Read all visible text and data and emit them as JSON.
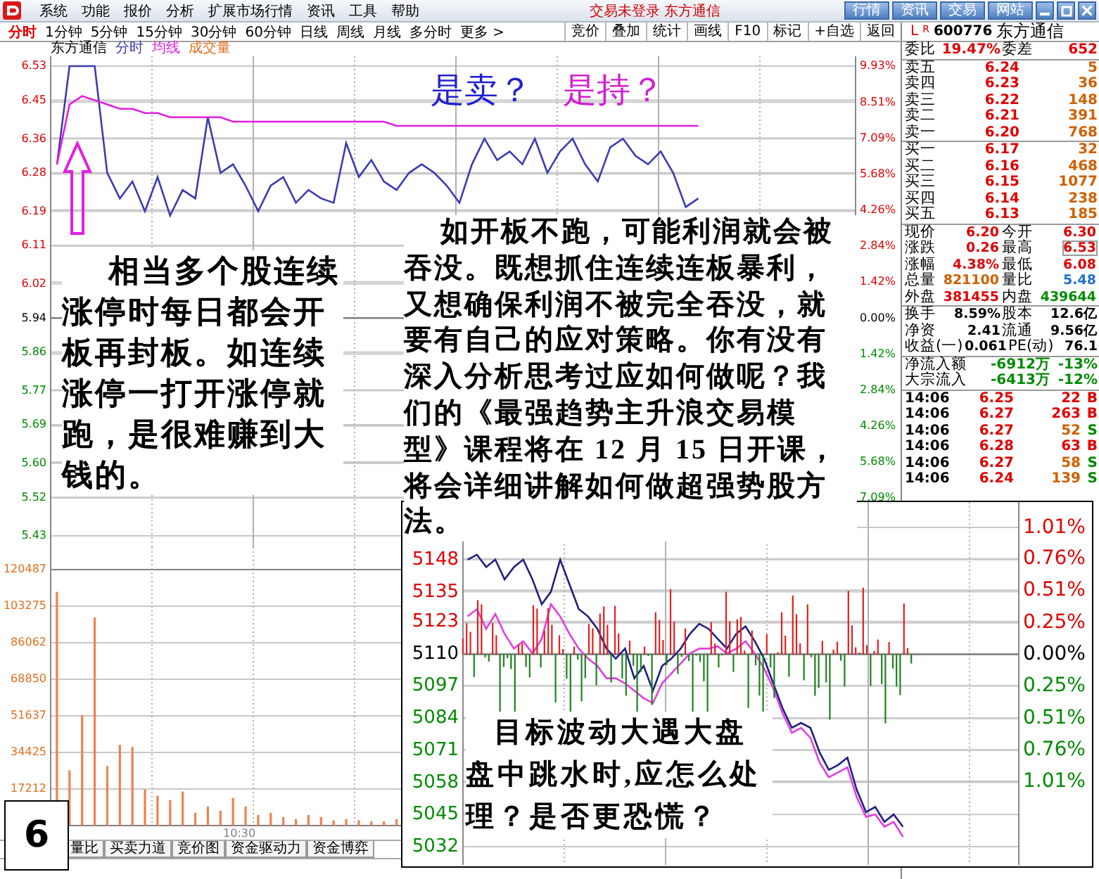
{
  "window": {
    "title": "交易未登录 东方通信"
  },
  "menu": [
    "系统",
    "功能",
    "报价",
    "分析",
    "扩展市场行情",
    "资讯",
    "工具",
    "帮助"
  ],
  "top_buttons": [
    "行情",
    "资讯",
    "交易",
    "网站"
  ],
  "periods": [
    {
      "label": "分时",
      "selected": true
    },
    {
      "label": "1分钟",
      "selected": false
    },
    {
      "label": "5分钟",
      "selected": false
    },
    {
      "label": "15分钟",
      "selected": false
    },
    {
      "label": "30分钟",
      "selected": false
    },
    {
      "label": "60分钟",
      "selected": false
    },
    {
      "label": "日线",
      "selected": false
    },
    {
      "label": "周线",
      "selected": false
    },
    {
      "label": "月线",
      "selected": false
    },
    {
      "label": "多分时",
      "selected": false
    },
    {
      "label": "更多 >",
      "selected": false
    }
  ],
  "tools": [
    "竞价",
    "叠加",
    "统计",
    "画线",
    "F10",
    "标记",
    "+自选",
    "返回"
  ],
  "chart_header": {
    "stock": "东方通信"
  },
  "price_chart": {
    "chart_data": {
      "type": "line",
      "grid": true,
      "ylim": [
        5.43,
        6.53
      ],
      "y2lim": [
        -8.59,
        9.93
      ],
      "yticks": [
        {
          "value": 6.53,
          "label": "6.53"
        },
        {
          "value": 6.45,
          "label": "6.45"
        },
        {
          "value": 6.36,
          "label": "6.36"
        },
        {
          "value": 6.28,
          "label": "6.28"
        },
        {
          "value": 6.19,
          "label": "6.19"
        },
        {
          "value": 6.11,
          "label": "6.11"
        },
        {
          "value": 6.02,
          "label": "6.02"
        },
        {
          "value": 5.94,
          "label": "5.94"
        },
        {
          "value": 5.86,
          "label": "5.86"
        },
        {
          "value": 5.77,
          "label": "5.77"
        },
        {
          "value": 5.69,
          "label": "5.69"
        },
        {
          "value": 5.6,
          "label": "5.60"
        },
        {
          "value": 5.52,
          "label": "5.52"
        },
        {
          "value": 5.43,
          "label": "5.43"
        }
      ],
      "y2ticks": [
        {
          "value": 9.93,
          "label": "9.93%"
        },
        {
          "value": 8.51,
          "label": "8.51%"
        },
        {
          "value": 7.09,
          "label": "7.09%"
        },
        {
          "value": 5.68,
          "label": "5.68%"
        },
        {
          "value": 4.26,
          "label": "4.26%"
        },
        {
          "value": 2.84,
          "label": "2.84%"
        },
        {
          "value": 1.42,
          "label": "1.42%"
        },
        {
          "value": 0,
          "label": "0.00%"
        },
        {
          "value": -1.42,
          "label": "1.42%"
        },
        {
          "value": -2.84,
          "label": "2.84%"
        },
        {
          "value": -4.26,
          "label": "4.26%"
        },
        {
          "value": -5.68,
          "label": "5.68%"
        },
        {
          "value": -7.09,
          "label": "7.09%"
        }
      ],
      "categories": [
        null,
        null,
        null,
        null,
        null,
        null,
        null,
        null,
        null,
        null,
        null,
        null,
        null,
        null,
        null,
        null,
        null,
        null,
        null,
        null,
        null,
        null,
        null,
        null,
        null,
        null,
        null,
        null,
        null,
        null,
        null,
        null,
        null,
        null,
        null,
        null,
        null,
        null,
        null,
        null,
        null,
        null,
        null,
        null,
        null,
        null,
        null,
        null,
        null,
        null,
        null,
        null,
        null,
        null,
        null,
        null,
        null,
        null,
        null,
        null,
        null,
        null,
        null,
        null
      ],
      "series": [
        {
          "name": "分时",
          "color": "#3c3cb0",
          "values": [
            6.3,
            6.53,
            6.53,
            6.53,
            6.28,
            6.22,
            6.26,
            6.19,
            6.27,
            6.18,
            6.24,
            6.22,
            6.41,
            6.28,
            6.3,
            6.25,
            6.19,
            6.25,
            6.27,
            6.21,
            6.24,
            6.22,
            6.21,
            6.35,
            6.27,
            6.31,
            6.26,
            6.24,
            6.28,
            6.3,
            6.28,
            6.25,
            6.21,
            6.3,
            6.36,
            6.31,
            6.33,
            6.3,
            6.36,
            6.28,
            6.33,
            6.36,
            6.3,
            6.26,
            6.34,
            6.36,
            6.32,
            6.3,
            6.33,
            6.28,
            6.2,
            6.22,
            null,
            null,
            null,
            null,
            null,
            null,
            null,
            null,
            null,
            null,
            null,
            null
          ]
        },
        {
          "name": "均线",
          "color": "#e020e0",
          "values": [
            6.3,
            6.44,
            6.46,
            6.45,
            6.44,
            6.43,
            6.43,
            6.42,
            6.42,
            6.41,
            6.41,
            6.41,
            6.41,
            6.41,
            6.4,
            6.4,
            6.4,
            6.4,
            6.4,
            6.4,
            6.4,
            6.4,
            6.4,
            6.4,
            6.4,
            6.4,
            6.4,
            6.39,
            6.39,
            6.39,
            6.39,
            6.39,
            6.39,
            6.39,
            6.39,
            6.39,
            6.39,
            6.39,
            6.39,
            6.39,
            6.39,
            6.39,
            6.39,
            6.39,
            6.39,
            6.39,
            6.39,
            6.39,
            6.39,
            6.39,
            6.39,
            6.39,
            null,
            null,
            null,
            null,
            null,
            null,
            null,
            null,
            null,
            null,
            null,
            null
          ]
        }
      ]
    }
  },
  "volume_chart": {
    "chart_data": {
      "type": "bar",
      "title": "成交量",
      "grid": true,
      "ylim": [
        0,
        120487
      ],
      "yticks": [
        {
          "value": 120487,
          "label": "120487"
        },
        {
          "value": 103275,
          "label": "103275"
        },
        {
          "value": 86062,
          "label": "86062"
        },
        {
          "value": 68850,
          "label": "68850"
        },
        {
          "value": 51637,
          "label": "51637"
        },
        {
          "value": 34425,
          "label": "34425"
        },
        {
          "value": 17212,
          "label": "17212"
        }
      ],
      "categories": [
        null,
        null,
        null,
        null,
        null,
        null,
        null,
        null,
        null,
        null,
        null,
        null,
        null,
        null,
        null,
        null,
        null,
        null,
        null,
        null,
        null,
        null,
        null,
        null,
        null,
        null,
        null,
        null,
        null,
        null,
        null,
        null,
        null,
        null,
        null,
        null,
        null,
        null,
        null,
        null,
        null,
        null,
        null,
        null,
        null,
        null,
        null,
        null,
        null,
        null,
        null,
        null,
        null,
        null,
        null,
        null,
        null,
        null,
        null,
        null,
        null,
        null,
        null,
        null
      ],
      "values": [
        110000,
        26000,
        52000,
        98000,
        28000,
        38000,
        37000,
        17000,
        14000,
        12000,
        16000,
        6000,
        9000,
        7000,
        13000,
        9000,
        5000,
        6000,
        4000,
        3000,
        5000,
        4000,
        2500,
        3000,
        2500,
        2000,
        2000,
        3000,
        null,
        null,
        null,
        null,
        null,
        null,
        null,
        null,
        null,
        null,
        null,
        null,
        null,
        null,
        null,
        null,
        null,
        null,
        null,
        null,
        null,
        null,
        null,
        null,
        null,
        null,
        null,
        null,
        null,
        null,
        null,
        null,
        null,
        null,
        null,
        null
      ],
      "annotations": [
        "10:30"
      ]
    }
  },
  "bottom_tabs": [
    "量比",
    "买卖力道",
    "竞价图",
    "资金驱动力",
    "资金博弈"
  ],
  "quote": {
    "header": {
      "market": "L",
      "flag": "R",
      "code": "600776",
      "name": "东方通信"
    },
    "order_ratio": [
      {
        "label": "委比",
        "value": "19.47%",
        "color": "#e00000"
      },
      {
        "label": "委差",
        "value": "652",
        "color": "#e00000"
      }
    ],
    "asks": [
      {
        "label": "卖五",
        "price": "6.24",
        "volume": "5"
      },
      {
        "label": "卖四",
        "price": "6.23",
        "volume": "36"
      },
      {
        "label": "卖三",
        "price": "6.22",
        "volume": "148"
      },
      {
        "label": "卖二",
        "price": "6.21",
        "volume": "391"
      },
      {
        "label": "卖一",
        "price": "6.20",
        "volume": "768"
      }
    ],
    "bids": [
      {
        "label": "买一",
        "price": "6.17",
        "volume": "32"
      },
      {
        "label": "买二",
        "price": "6.16",
        "volume": "468"
      },
      {
        "label": "买三",
        "price": "6.15",
        "volume": "1077"
      },
      {
        "label": "买四",
        "price": "6.14",
        "volume": "238"
      },
      {
        "label": "买五",
        "price": "6.13",
        "volume": "185"
      }
    ],
    "stats": [
      {
        "cells": [
          {
            "label": "现价",
            "value": "6.20",
            "color": "#e00000",
            "highlighted": false
          },
          {
            "label": "今开",
            "value": "6.30",
            "color": "#e00000",
            "highlighted": false
          }
        ]
      },
      {
        "cells": [
          {
            "label": "涨跌",
            "value": "0.26",
            "color": "#e00000",
            "highlighted": false
          },
          {
            "label": "最高",
            "value": "6.53",
            "color": "#e00000",
            "highlighted": true
          }
        ]
      },
      {
        "cells": [
          {
            "label": "涨幅",
            "value": "4.38%",
            "color": "#e00000",
            "highlighted": false
          },
          {
            "label": "最低",
            "value": "6.08",
            "color": "#e00000",
            "highlighted": false
          }
        ]
      },
      {
        "cells": [
          {
            "label": "总量",
            "value": "821100",
            "color": "#d06000",
            "highlighted": false
          },
          {
            "label": "量比",
            "value": "5.48",
            "color": "#2070d0",
            "highlighted": false
          }
        ]
      },
      {
        "cells": [
          {
            "label": "外盘",
            "value": "381455",
            "color": "#e00000",
            "highlighted": false
          },
          {
            "label": "内盘",
            "value": "439644",
            "color": "#008a00",
            "highlighted": false
          }
        ]
      }
    ],
    "fundamentals": [
      {
        "cells": [
          {
            "label": "换手",
            "value": "8.59%"
          },
          {
            "label": "股本",
            "value": "12.6亿"
          }
        ]
      },
      {
        "cells": [
          {
            "label": "净资",
            "value": "2.41"
          },
          {
            "label": "流通",
            "value": "9.56亿"
          }
        ]
      },
      {
        "cells": [
          {
            "label": "收益(一)",
            "value": "0.061"
          },
          {
            "label": "PE(动)",
            "value": "76.1"
          }
        ]
      }
    ],
    "flows": [
      {
        "label": "净流入额",
        "amount": "-6912万",
        "percent": "-13%"
      },
      {
        "label": "大宗流入",
        "amount": "-6413万",
        "percent": "-12%"
      }
    ],
    "trades": [
      {
        "time": "14:06",
        "price": "6.25",
        "volume": "22",
        "side": "B",
        "kind": "buy"
      },
      {
        "time": "14:06",
        "price": "6.27",
        "volume": "263",
        "side": "B",
        "kind": "buy"
      },
      {
        "time": "14:06",
        "price": "6.27",
        "volume": "52",
        "side": "S",
        "kind": "sell"
      },
      {
        "time": "14:06",
        "price": "6.28",
        "volume": "63",
        "side": "B",
        "kind": "buy"
      },
      {
        "time": "14:06",
        "price": "6.27",
        "volume": "58",
        "side": "S",
        "kind": "sell"
      },
      {
        "time": "14:06",
        "price": "6.24",
        "volume": "139",
        "side": "S",
        "kind": "sell"
      }
    ]
  },
  "questions": [
    {
      "text": "是卖？",
      "color": "#2020d0"
    },
    {
      "text": "是持？",
      "color": "#d020d0"
    }
  ],
  "note_left": "相当多个股连续涨停时每日都会开板再封板。如连续涨停一打开涨停就跑，是很难赚到大钱的。",
  "note_main": "如开板不跑，可能利润就会被吞没。既想抓住连续连板暴利，又想确保利润不被完全吞没，就要有自己的应对策略。你有没有深入分析思考过应如何做呢？我们的《最强趋势主升浪交易模型》课程将在 12 月 15 日开课，将会详细讲解如何做超强势股方法。",
  "index_inset": {
    "chart_data": {
      "type": "line",
      "grid": true,
      "ylim": [
        5032,
        5161
      ],
      "y2lim": [
        -1.53,
        1.01
      ],
      "yticks": [
        {
          "value": 5148,
          "label": "5148"
        },
        {
          "value": 5135,
          "label": "5135"
        },
        {
          "value": 5123,
          "label": "5123"
        },
        {
          "value": 5110,
          "label": "5110"
        },
        {
          "value": 5097,
          "label": "5097"
        },
        {
          "value": 5084,
          "label": "5084"
        },
        {
          "value": 5071,
          "label": "5071"
        },
        {
          "value": 5058,
          "label": "5058"
        },
        {
          "value": 5045,
          "label": "5045"
        },
        {
          "value": 5032,
          "label": "5032"
        }
      ],
      "y2ticks": [
        {
          "value": 1.01,
          "label": "1.01%"
        },
        {
          "value": 0.76,
          "label": "0.76%"
        },
        {
          "value": 0.51,
          "label": "0.51%"
        },
        {
          "value": 0.25,
          "label": "0.25%"
        },
        {
          "value": 0,
          "label": "0.00%"
        },
        {
          "value": -0.25,
          "label": "0.25%"
        },
        {
          "value": -0.51,
          "label": "0.51%"
        },
        {
          "value": -0.76,
          "label": "0.76%"
        },
        {
          "value": -1.01,
          "label": "1.01%"
        }
      ],
      "categories": [
        null,
        null,
        null,
        null,
        null,
        null,
        null,
        null,
        null,
        null,
        null,
        null,
        null,
        null,
        null,
        null,
        null,
        null,
        null,
        null,
        null,
        null,
        null,
        null,
        null,
        null,
        null,
        null,
        null,
        null,
        null,
        null,
        null,
        null,
        null,
        null,
        null,
        null,
        null,
        null,
        null,
        null,
        null,
        null,
        null,
        null,
        null,
        null,
        null,
        null,
        null,
        null,
        null,
        null,
        null,
        null,
        null,
        null,
        null,
        null
      ],
      "series": [
        {
          "color": "#202080",
          "values": [
            5148,
            5150,
            5145,
            5148,
            5140,
            5145,
            5148,
            5140,
            5130,
            5135,
            5148,
            5138,
            5128,
            5125,
            5120,
            5112,
            5108,
            5112,
            5100,
            5105,
            5095,
            5105,
            5108,
            5112,
            5118,
            5122,
            5120,
            5116,
            5112,
            5118,
            5121,
            5115,
            5108,
            5098,
            5088,
            5080,
            5082,
            5080,
            5070,
            5063,
            5065,
            5068,
            5055,
            5046,
            5048,
            5042,
            5045,
            5040,
            null,
            null,
            null,
            null,
            null,
            null,
            null,
            null,
            null,
            null,
            null,
            null
          ]
        },
        {
          "color": "#e040e0",
          "values": [
            5125,
            5128,
            5120,
            5126,
            5118,
            5112,
            5115,
            5110,
            5116,
            5130,
            5125,
            5118,
            5112,
            5108,
            5105,
            5100,
            5100,
            5098,
            5095,
            5092,
            5090,
            5098,
            5102,
            5106,
            5110,
            5112,
            5112,
            5113,
            5110,
            5112,
            5115,
            5110,
            5104,
            5096,
            5086,
            5078,
            5080,
            5076,
            5066,
            5060,
            5062,
            5064,
            5052,
            5044,
            5045,
            5040,
            5042,
            5036,
            null,
            null,
            null,
            null,
            null,
            null,
            null,
            null,
            null,
            null,
            null,
            null
          ]
        }
      ]
    },
    "note": "目标波动大遇大盘盘中跳水时,应怎么处理？是否更恐慌？"
  },
  "page_number": "6"
}
